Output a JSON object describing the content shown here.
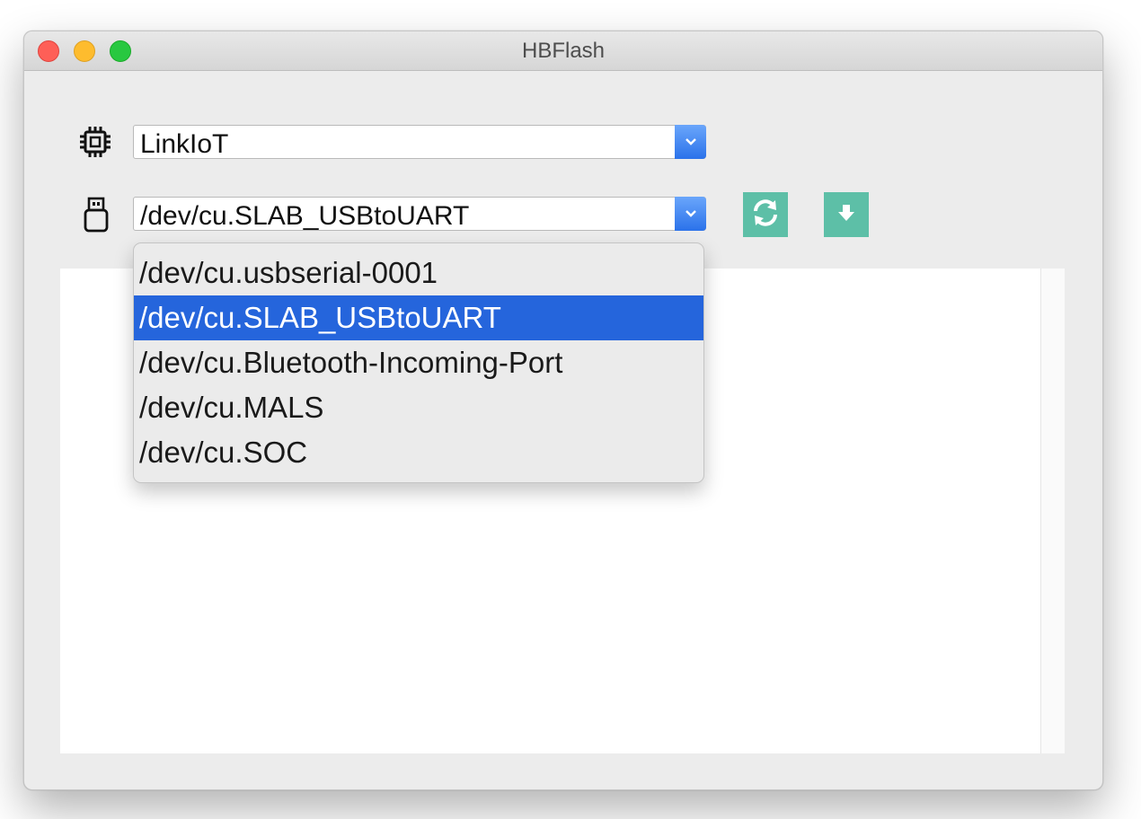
{
  "window": {
    "title": "HBFlash"
  },
  "board": {
    "icon": "chip-icon",
    "selected": "LinkIoT"
  },
  "port": {
    "icon": "usb-drive-icon",
    "selected": "/dev/cu.SLAB_USBtoUART",
    "options": [
      "/dev/cu.usbserial-0001",
      "/dev/cu.SLAB_USBtoUART",
      "/dev/cu.Bluetooth-Incoming-Port",
      "/dev/cu.MALS",
      "/dev/cu.SOC"
    ],
    "highlighted_index": 1
  },
  "toolbar": {
    "refresh_icon": "refresh-icon",
    "download_icon": "download-icon"
  },
  "colors": {
    "accent": "#2565dc",
    "button_teal": "#5dbfa7",
    "close": "#fe5f57",
    "minimize": "#febc2e",
    "zoom": "#28c840"
  }
}
